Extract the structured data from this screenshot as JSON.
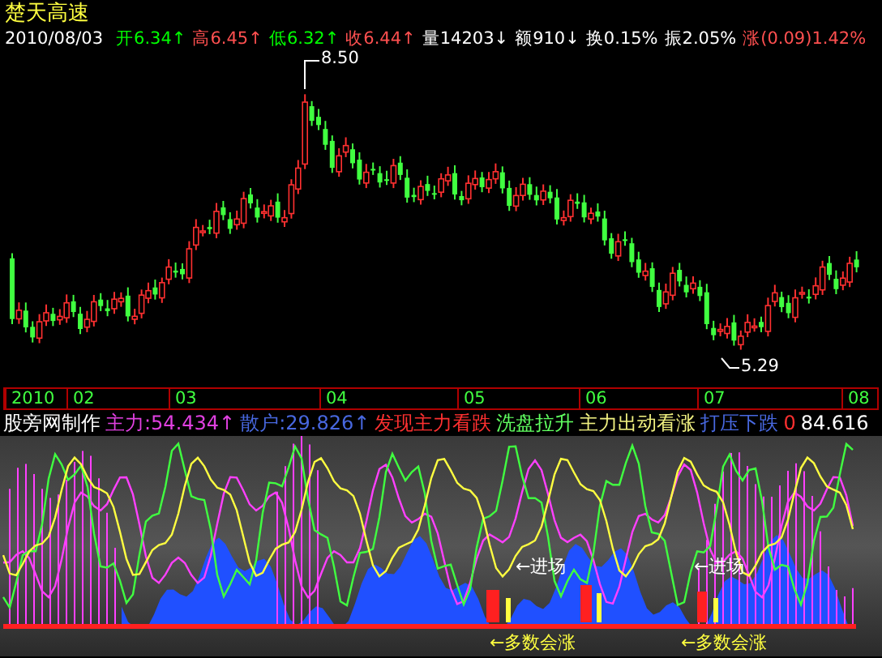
{
  "stock_name": "楚天高速",
  "quote": {
    "date": "2010/08/03",
    "fields": [
      {
        "text": "开6.34",
        "arrow": "↑",
        "color": "#00ff00"
      },
      {
        "text": "高6.45",
        "arrow": "↑",
        "color": "#ff5050"
      },
      {
        "text": "低6.32",
        "arrow": "↑",
        "color": "#00ff00"
      },
      {
        "text": "收6.44",
        "arrow": "↑",
        "color": "#ff5050"
      },
      {
        "text": "量14203",
        "arrow": "↓",
        "color": "#ffffff"
      },
      {
        "text": "额910",
        "arrow": "↓",
        "color": "#ffffff"
      },
      {
        "text": "换0.15%",
        "color": "#ffffff"
      },
      {
        "text": "振2.05%",
        "color": "#ffffff"
      },
      {
        "text": "涨(0.09)1.42%",
        "color": "#ff5050"
      }
    ]
  },
  "price_marks": {
    "high": "8.50",
    "low": "5.29"
  },
  "time_axis": [
    "2010",
    "02",
    "03",
    "04",
    "05",
    "06",
    "07",
    "08"
  ],
  "indicator_legend": [
    {
      "text": "股旁网制作",
      "color": "#ffffff"
    },
    {
      "text": "主力:54.434↑",
      "color": "#e040e0"
    },
    {
      "text": "散户:29.826↑",
      "color": "#4868e0"
    },
    {
      "text": "发现主力看跌",
      "color": "#ff3030"
    },
    {
      "text": "洗盘拉升",
      "color": "#60ff60"
    },
    {
      "text": "主力出动看涨",
      "color": "#f0f080"
    },
    {
      "text": "打压下跌",
      "color": "#4868e0"
    },
    {
      "text": "0",
      "color": "#ff3030"
    },
    {
      "text": "84.616",
      "color": "#ffffff"
    }
  ],
  "entry_signals": [
    "←进场",
    "←进场"
  ],
  "rise_signals": [
    "←多数会涨",
    "←多数会涨"
  ]
}
